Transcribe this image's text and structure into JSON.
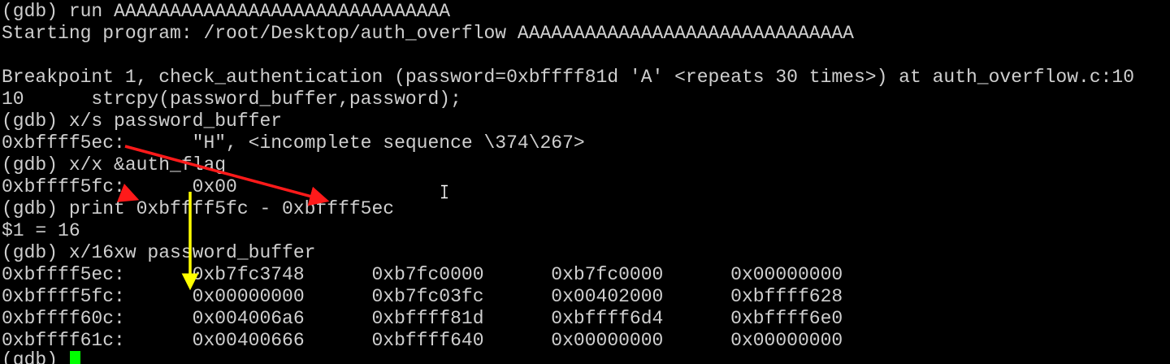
{
  "terminal": {
    "lines": [
      "(gdb) run AAAAAAAAAAAAAAAAAAAAAAAAAAAAAA",
      "Starting program: /root/Desktop/auth_overflow AAAAAAAAAAAAAAAAAAAAAAAAAAAAAA",
      "",
      "Breakpoint 1, check_authentication (password=0xbffff81d 'A' <repeats 30 times>) at auth_overflow.c:10",
      "10      strcpy(password_buffer,password);",
      "(gdb) x/s password_buffer",
      "0xbffff5ec:      \"H\", <incomplete sequence \\374\\267>",
      "(gdb) x/x &auth_flag",
      "0xbffff5fc:      0x00",
      "(gdb) print 0xbffff5fc - 0xbffff5ec",
      "$1 = 16",
      "(gdb) x/16xw password_buffer",
      "0xbffff5ec:      0xb7fc3748      0xb7fc0000      0xb7fc0000      0x00000000",
      "0xbffff5fc:      0x00000000      0xb7fc03fc      0x00402000      0xbffff628",
      "0xbffff60c:      0x004006a6      0xbffff81d      0xbffff6d4      0xbffff6e0",
      "0xbffff61c:      0x00400666      0xbffff640      0x00000000      0x00000000"
    ],
    "prompt": "(gdb) ",
    "colors": {
      "background": "#000000",
      "text": "#cfcfcf",
      "cursor": "#00ff00",
      "annotation_red": "#ff1a1a",
      "annotation_yellow": "#ffff00",
      "mouse_cursor": "#ffffff"
    },
    "icons": {
      "mouse_cursor": "i-beam-icon"
    }
  }
}
